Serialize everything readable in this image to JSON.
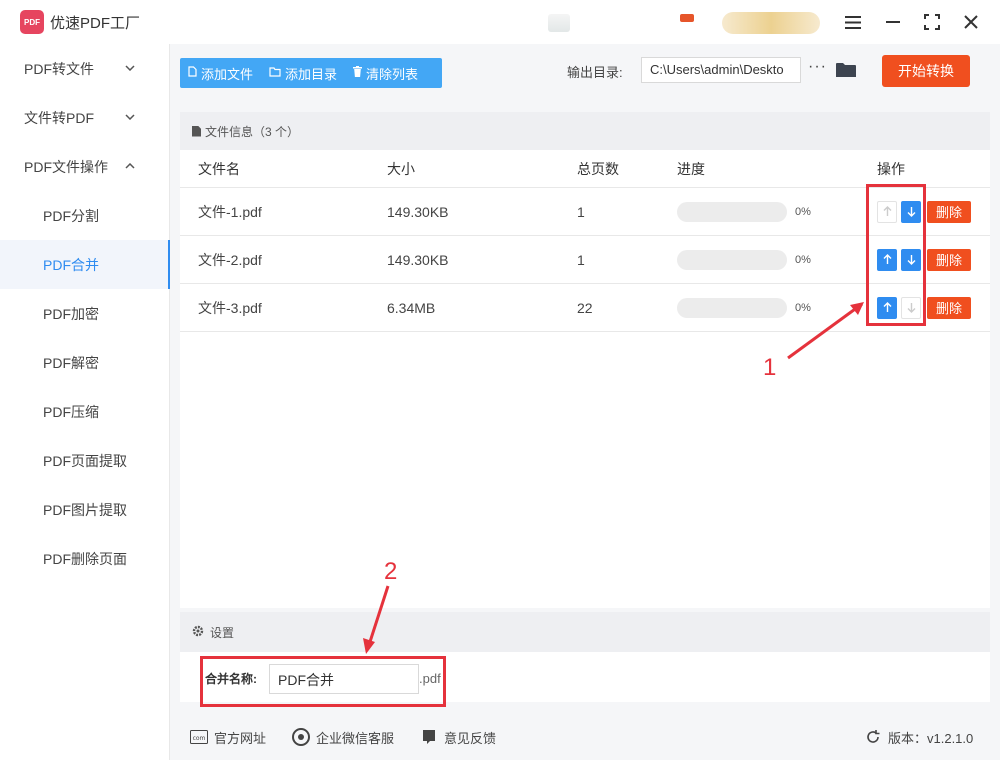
{
  "app": {
    "title": "优速PDF工厂",
    "logo_text": "PDF"
  },
  "sidebar": {
    "items": [
      {
        "label": "PDF转文件",
        "chevron": "⌄"
      },
      {
        "label": "文件转PDF",
        "chevron": "⌄"
      },
      {
        "label": "PDF文件操作",
        "chevron": "⌃"
      },
      {
        "label": "PDF分割"
      },
      {
        "label": "PDF合并"
      },
      {
        "label": "PDF加密"
      },
      {
        "label": "PDF解密"
      },
      {
        "label": "PDF压缩"
      },
      {
        "label": "PDF页面提取"
      },
      {
        "label": "PDF图片提取"
      },
      {
        "label": "PDF删除页面"
      }
    ]
  },
  "toolbar": {
    "add_file": "添加文件",
    "add_dir": "添加目录",
    "clear_list": "清除列表",
    "output_label": "输出目录:",
    "output_path": "C:\\Users\\admin\\Deskto",
    "more": "···",
    "start": "开始转换"
  },
  "files": {
    "header": "文件信息（3 个）",
    "columns": {
      "name": "文件名",
      "size": "大小",
      "pages": "总页数",
      "progress": "进度",
      "ops": "操作"
    },
    "rows": [
      {
        "name": "文件-1.pdf",
        "size": "149.30KB",
        "pages": "1",
        "progress": "0%",
        "progress_value": 0,
        "delete": "删除"
      },
      {
        "name": "文件-2.pdf",
        "size": "149.30KB",
        "pages": "1",
        "progress": "0%",
        "progress_value": 0,
        "delete": "删除"
      },
      {
        "name": "文件-3.pdf",
        "size": "6.34MB",
        "pages": "22",
        "progress": "0%",
        "progress_value": 0,
        "delete": "删除"
      }
    ]
  },
  "settings": {
    "header": "设置",
    "merge_label": "合并名称:",
    "merge_value": "PDF合并",
    "ext": ".pdf"
  },
  "footer": {
    "website": "官方网址",
    "wechat": "企业微信客服",
    "feedback": "意见反馈",
    "version": "版本：v1.2.1.0"
  },
  "annotations": {
    "n1": "1",
    "n2": "2",
    "color": "#e5323c"
  },
  "icons": {
    "menu": "menu-icon",
    "minimize": "minimize-icon",
    "maximize": "maximize-icon",
    "close": "close-icon",
    "file": "file-icon",
    "folder": "folder-icon",
    "trash": "trash-icon",
    "gear": "gear-icon",
    "up": "arrow-up-icon",
    "down": "arrow-down-icon"
  }
}
